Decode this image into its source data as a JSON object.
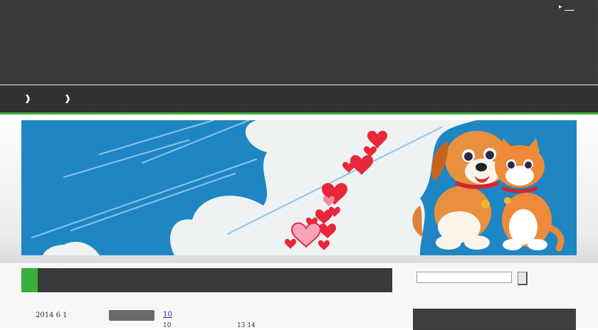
{
  "header": {
    "top_link_arrow": "▸"
  },
  "nav": {
    "items": [
      {
        "arrow": "❱"
      },
      {
        "arrow": "❱"
      }
    ]
  },
  "banner": {
    "icon": "dog-and-cat-illustration",
    "colors": {
      "sky": "#1f86c4",
      "cloud": "#eef2f2",
      "heart": "#e8283a"
    }
  },
  "post": {
    "date": "2014 6 1",
    "link": "10",
    "sub_left": "10",
    "sub_right": "13 14"
  },
  "search": {
    "placeholder": "",
    "value": ""
  },
  "colors": {
    "accent": "#3db03d",
    "dark": "#3a3a3a"
  }
}
